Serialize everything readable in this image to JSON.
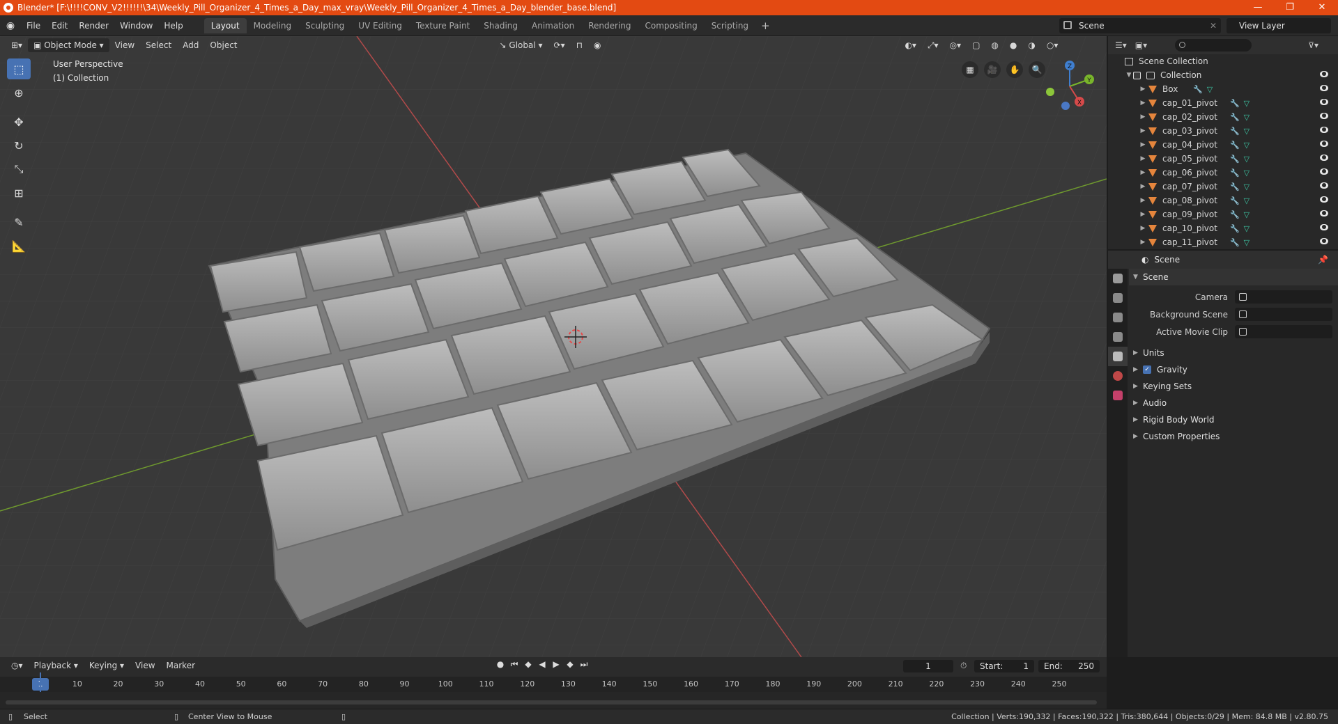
{
  "window": {
    "title": "Blender* [F:\\!!!!CONV_V2!!!!!!\\34\\Weekly_Pill_Organizer_4_Times_a_Day_max_vray\\Weekly_Pill_Organizer_4_Times_a_Day_blender_base.blend]",
    "minimize": "—",
    "maximize": "❐",
    "close": "✕"
  },
  "menu": {
    "items": [
      "File",
      "Edit",
      "Render",
      "Window",
      "Help"
    ],
    "workspaces": [
      "Layout",
      "Modeling",
      "Sculpting",
      "UV Editing",
      "Texture Paint",
      "Shading",
      "Animation",
      "Rendering",
      "Compositing",
      "Scripting"
    ],
    "active_workspace": "Layout",
    "add_tab": "+",
    "scene": "Scene",
    "view_layer": "View Layer"
  },
  "viewport": {
    "mode": "Object Mode",
    "menus": [
      "View",
      "Select",
      "Add",
      "Object"
    ],
    "transform_orientation": "Global",
    "info_line1": "User Perspective",
    "info_line2": "(1) Collection",
    "gizmo": {
      "z": "Z",
      "y": "Y",
      "x": "X"
    }
  },
  "outliner": {
    "root": "Scene Collection",
    "collection": "Collection",
    "objects": [
      "Box",
      "cap_01_pivot",
      "cap_02_pivot",
      "cap_03_pivot",
      "cap_04_pivot",
      "cap_05_pivot",
      "cap_06_pivot",
      "cap_07_pivot",
      "cap_08_pivot",
      "cap_09_pivot",
      "cap_10_pivot",
      "cap_11_pivot"
    ]
  },
  "properties": {
    "context": "Scene",
    "panel": "Scene",
    "camera_label": "Camera",
    "background_scene_label": "Background Scene",
    "active_movie_clip_label": "Active Movie Clip",
    "sections": [
      "Units",
      "Gravity",
      "Keying Sets",
      "Audio",
      "Rigid Body World",
      "Custom Properties"
    ],
    "gravity_checked": true
  },
  "timeline": {
    "menus": [
      "Playback",
      "Keying",
      "View",
      "Marker"
    ],
    "current_frame": "1",
    "start_label": "Start:",
    "start": "1",
    "end_label": "End:",
    "end": "250",
    "ruler_current": "1",
    "ruler_ticks": [
      "10",
      "20",
      "30",
      "40",
      "50",
      "60",
      "70",
      "80",
      "90",
      "100",
      "110",
      "120",
      "130",
      "140",
      "150",
      "160",
      "170",
      "180",
      "190",
      "200",
      "210",
      "220",
      "230",
      "240",
      "250"
    ]
  },
  "status": {
    "left": "Select",
    "center": "Center View to Mouse",
    "right": "Collection | Verts:190,332 | Faces:190,322 | Tris:380,644 | Objects:0/29 | Mem: 84.8 MB | v2.80.75"
  },
  "colors": {
    "accent": "#4772b3",
    "titlebar": "#e34a12",
    "object_icon": "#e5853c",
    "axis_x": "#b24a4a",
    "axis_y": "#6f9a2e"
  }
}
